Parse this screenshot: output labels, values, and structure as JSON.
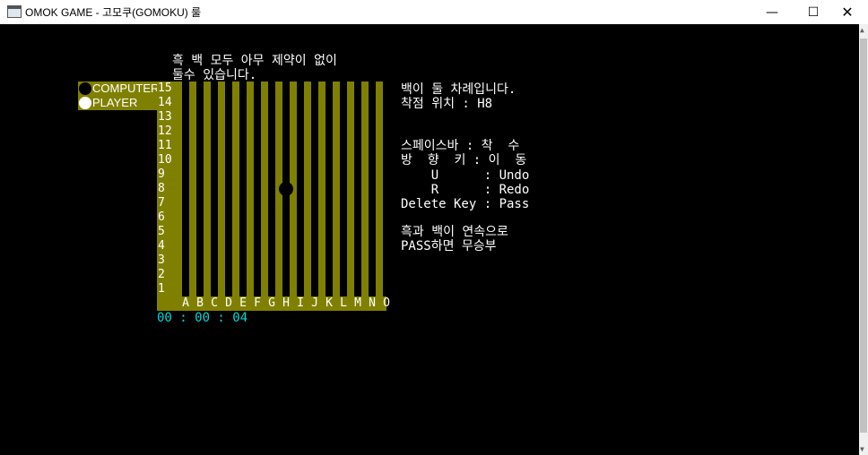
{
  "window": {
    "title": "OMOK GAME - 고모쿠(GOMOKU) 룰",
    "min_label": "—",
    "max_label": "☐",
    "close_label": "✕"
  },
  "rule_text": [
    "흑 백 모두 아무 제약이 없이",
    "둘수 있습니다."
  ],
  "legend": [
    {
      "label": "COMPUTER",
      "stone": "black"
    },
    {
      "label": "PLAYER",
      "stone": "white"
    }
  ],
  "board": {
    "rows": [
      "15",
      "14",
      "13",
      "12",
      "11",
      "10",
      "9",
      "8",
      "7",
      "6",
      "5",
      "4",
      "3",
      "2",
      "1"
    ],
    "columns": [
      "A",
      "B",
      "C",
      "D",
      "E",
      "F",
      "G",
      "H",
      "I",
      "J",
      "K",
      "L",
      "M",
      "N",
      "O"
    ],
    "stones": [
      {
        "col": "H",
        "row": "8",
        "color": "black"
      }
    ]
  },
  "timer": "00 : 00 : 04",
  "status": {
    "turn": "백이 둘 차례입니다.",
    "position": "착점 위치 : H8"
  },
  "help": [
    "스페이스바 : 착  수",
    "방  향  키 : 이  동",
    "    U      : Undo",
    "    R      : Redo",
    "Delete Key : Pass"
  ],
  "note": [
    "흑과 백이 연속으로",
    "PASS하면 무승부"
  ],
  "colors": {
    "board": "#808000",
    "timer": "#00d8d8",
    "text": "#ffffff"
  }
}
